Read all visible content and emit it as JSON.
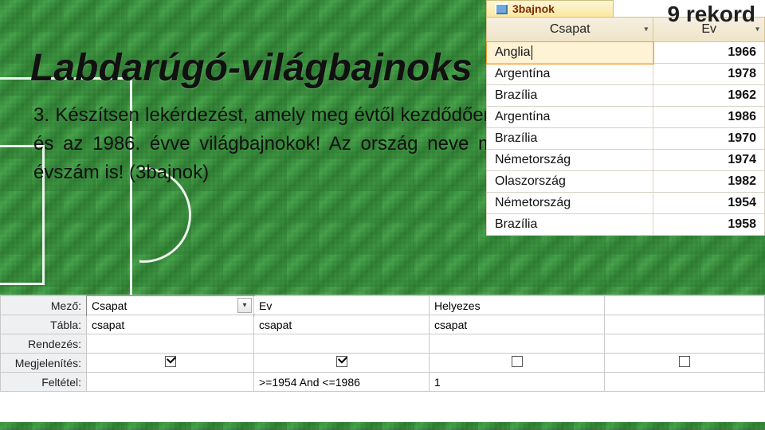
{
  "record_count_label": "9 rekord",
  "title": "Labdarúgó-világbajnoks",
  "task_text": "3. Készítsen lekérdezést, amely meg évtől kezdődően és az 1986. évve világbajnokok! Az ország neve m évszám is! (3bajnok)",
  "result_tab": {
    "label": "3bajnok"
  },
  "result_columns": [
    "Csapat",
    "Ev"
  ],
  "result_rows": [
    {
      "csapat": "Anglia",
      "ev": "1966",
      "selected": true
    },
    {
      "csapat": "Argentína",
      "ev": "1978"
    },
    {
      "csapat": "Brazília",
      "ev": "1962"
    },
    {
      "csapat": "Argentína",
      "ev": "1986"
    },
    {
      "csapat": "Brazília",
      "ev": "1970"
    },
    {
      "csapat": "Németország",
      "ev": "1974"
    },
    {
      "csapat": "Olaszország",
      "ev": "1982"
    },
    {
      "csapat": "Németország",
      "ev": "1954"
    },
    {
      "csapat": "Brazília",
      "ev": "1958"
    }
  ],
  "design": {
    "row_labels": [
      "Mező:",
      "Tábla:",
      "Rendezés:",
      "Megjelenítés:",
      "Feltétel:"
    ],
    "cols": [
      {
        "field": "Csapat",
        "table": "csapat",
        "sort": "",
        "show": true,
        "criteria": "",
        "current": true
      },
      {
        "field": "Ev",
        "table": "csapat",
        "sort": "",
        "show": true,
        "criteria": ">=1954 And <=1986"
      },
      {
        "field": "Helyezes",
        "table": "csapat",
        "sort": "",
        "show": false,
        "criteria": "1"
      }
    ]
  }
}
